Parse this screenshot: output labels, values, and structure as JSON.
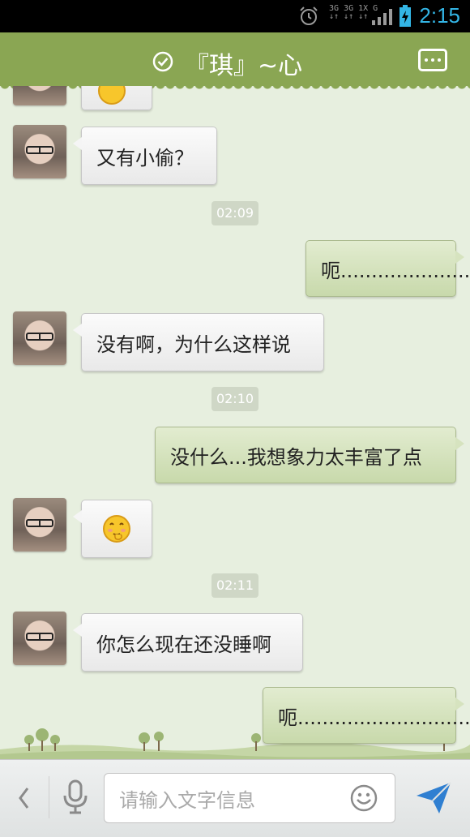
{
  "status_bar": {
    "time": "2:15",
    "network_line1": "3G 3G 1X  G",
    "network_line2": "↓↑ ↓↑  ↓↑",
    "icons": [
      "alarm-icon",
      "signal-icon",
      "battery-charging-icon"
    ]
  },
  "header": {
    "title": "『琪』~心",
    "icons": [
      "online-check-icon",
      "more-menu-icon"
    ]
  },
  "messages": [
    {
      "side": "left",
      "type": "emoji",
      "icon": "blush-emoji-icon"
    },
    {
      "side": "left",
      "type": "text",
      "text": "又有小偷？"
    },
    {
      "type": "time",
      "text": "02:09"
    },
    {
      "side": "right",
      "type": "text",
      "text": "呃....................."
    },
    {
      "side": "left",
      "type": "text",
      "text": "没有啊，为什么这样说"
    },
    {
      "type": "time",
      "text": "02:10"
    },
    {
      "side": "right",
      "type": "text",
      "text": "没什么...我想象力太丰富了点"
    },
    {
      "side": "left",
      "type": "emoji",
      "icon": "blush-emoji-icon"
    },
    {
      "type": "time",
      "text": "02:11"
    },
    {
      "side": "left",
      "type": "text",
      "text": "你怎么现在还没睡啊"
    },
    {
      "side": "right",
      "type": "text",
      "text": "呃............................."
    }
  ],
  "input_bar": {
    "placeholder": "请输入文字信息",
    "icons": [
      "back-arrow-icon",
      "microphone-icon",
      "smiley-icon",
      "send-icon"
    ]
  },
  "colors": {
    "header": "#8aa653",
    "background": "#e7efdf",
    "outgoing_bubble": "#d2e1b8",
    "incoming_bubble": "#f5f5f5",
    "status_accent": "#33b5e5"
  }
}
